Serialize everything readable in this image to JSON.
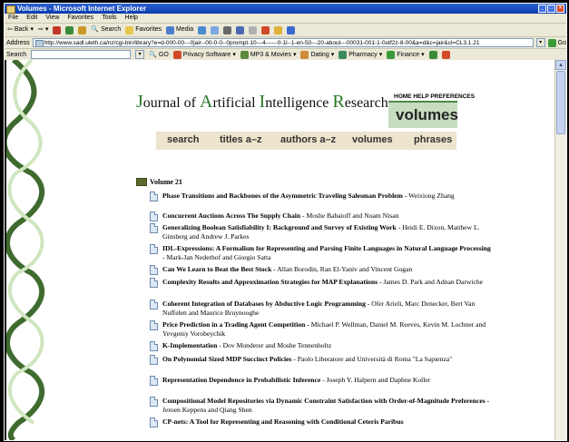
{
  "window": {
    "title": "Volumes - Microsoft Internet Explorer"
  },
  "menu": [
    "File",
    "Edit",
    "View",
    "Favorites",
    "Tools",
    "Help"
  ],
  "toolbar": {
    "back": "Back",
    "search": "Search",
    "favorites": "Favorites",
    "media": "Media"
  },
  "address": {
    "label": "Address",
    "url": "http://www.sadl.uleth.ca/nz/cgi-bin/library?e=d-000-00---0jair--00-0-0--0prompt-10---4------0-1l--1-en-50---20-about---00031-001-1-0utf2z-8-00&a=d&c=jair&cl=CL3.1.21",
    "go": "Go"
  },
  "links": {
    "search_label": "Search",
    "go": "GO",
    "items": [
      "Privacy Software",
      "MP3 & Movies",
      "Dating",
      "Pharmacy",
      "Finance"
    ]
  },
  "page": {
    "journal_title": [
      "J",
      "ournal of ",
      "A",
      "rtificial ",
      "I",
      "ntelligence ",
      "R",
      "esearch"
    ],
    "top_links": [
      "HOME",
      "HELP",
      "PREFERENCES"
    ],
    "section_label": "volumes",
    "nav": [
      "search",
      "titles a–z",
      "authors a–z",
      "volumes",
      "phrases"
    ],
    "volume_heading": "Volume 21",
    "papers": [
      {
        "title": "Phase Transitions and Backbones of the Asymmetric Traveling Salesman Problem",
        "authors": "Weixiong Zhang"
      },
      {
        "title": "Concurrent Auctions Across The Supply Chain",
        "authors": "Moshe Babaioff and Noam Nisan"
      },
      {
        "title": "Generalizing Boolean Satisfiability I: Background and Survey of Existing Work",
        "authors": "Heidi E. Dixon, Matthew L. Ginsberg and Andrew J. Parkes"
      },
      {
        "title": "IDL-Expressions: A Formalism for Representing and Parsing Finite Languages in Natural Language Processing",
        "authors": "Mark-Jan Nederhof and Giorgio Satta"
      },
      {
        "title": "Can We Learn to Beat the Best Stock",
        "authors": "Allan Borodin, Ran El-Yaniv and Vincent Gogan"
      },
      {
        "title": "Complexity Results and Approximation Strategies for MAP Explanations",
        "authors": "James D. Park and Adnan Darwiche"
      },
      {
        "title": "Coherent Integration of Databases by Abductive Logic Programming",
        "authors": "Ofer Arieli, Marc Denecker, Bert Van Nuffelen and Maurice Bruynooghe"
      },
      {
        "title": "Price Prediction in a Trading Agent Competition",
        "authors": "Michael P. Wellman, Daniel M. Reeves, Kevin M. Lochner and Yevgeniy Vorobeychik"
      },
      {
        "title": "K-Implementation",
        "authors": "Dov Monderer and Moshe Tennenholtz"
      },
      {
        "title": "On Polynomial Sized MDP Succinct Policies",
        "authors": "Paolo Liberatore and Università di Roma \"La Sapienza\""
      },
      {
        "title": "Representation Dependence in Probabilistic Inference",
        "authors": "Joseph Y. Halpern and Daphne Koller"
      },
      {
        "title": "Compositional Model Repositories via Dynamic Constraint Satisfaction with Order-of-Magnitude Preferences",
        "authors": "Jeroen Keppens and Qiang Shen"
      },
      {
        "title": "CP-nets: A Tool for Representing and Reasoning with Conditional Ceteris Paribus",
        "authors": ""
      }
    ]
  }
}
